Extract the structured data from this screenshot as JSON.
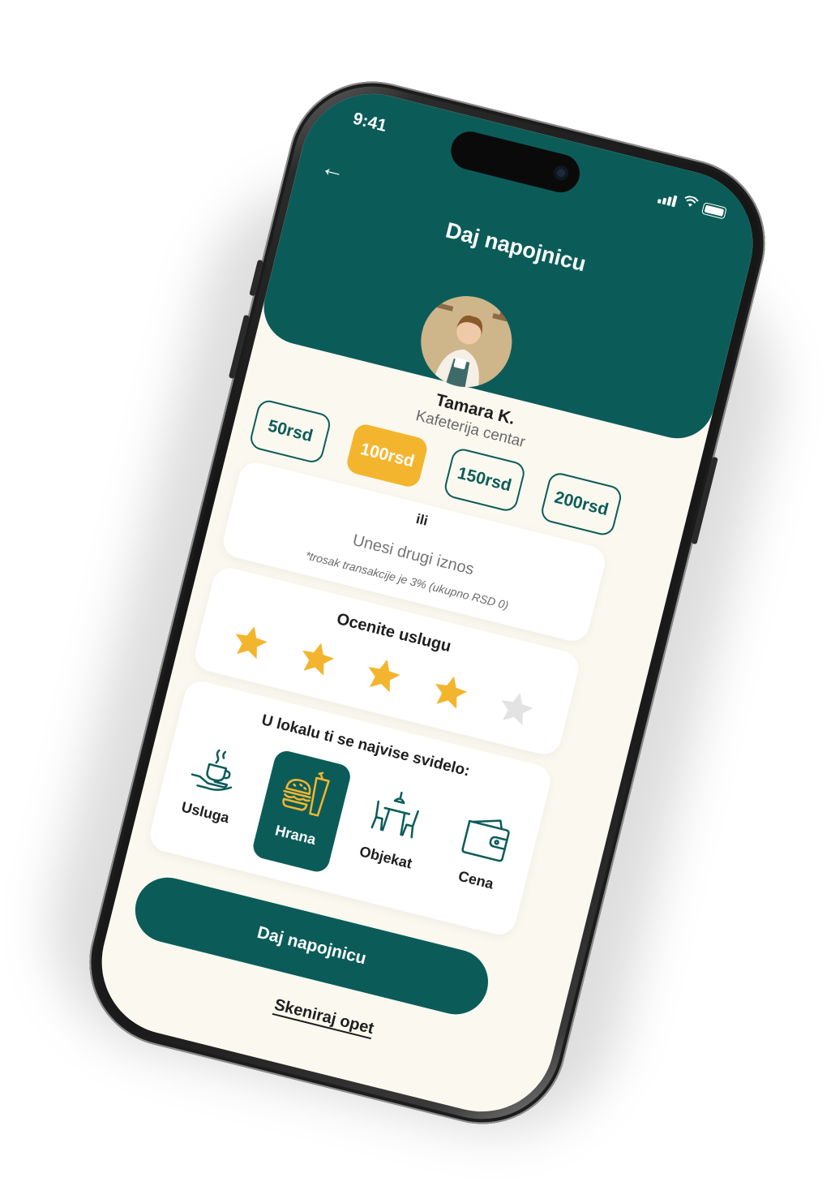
{
  "status_bar": {
    "time": "9:41"
  },
  "header": {
    "back_icon": "arrow-left-icon",
    "title": "Daj napojnicu"
  },
  "profile": {
    "name": "Tamara K.",
    "place": "Kafeterija centar"
  },
  "amounts": [
    {
      "label": "50rsd",
      "selected": false
    },
    {
      "label": "100rsd",
      "selected": true
    },
    {
      "label": "150rsd",
      "selected": false
    },
    {
      "label": "200rsd",
      "selected": false
    }
  ],
  "custom_amount": {
    "or_label": "ili",
    "placeholder": "Unesi drugi iznos",
    "fee_note": "*trosak transakcije je 3% (ukupno RSD 0)"
  },
  "rating": {
    "title": "Ocenite uslugu",
    "value": 4,
    "max": 5
  },
  "favorites": {
    "title": "U lokalu ti se najvise svidelo:",
    "items": [
      {
        "label": "Usluga",
        "icon": "coffee-serving-icon",
        "selected": false
      },
      {
        "label": "Hrana",
        "icon": "burger-drink-icon",
        "selected": true
      },
      {
        "label": "Objekat",
        "icon": "table-chairs-icon",
        "selected": false
      },
      {
        "label": "Cena",
        "icon": "wallet-icon",
        "selected": false
      }
    ]
  },
  "actions": {
    "submit_label": "Daj napojnicu",
    "rescan_label": "Skeniraj opet"
  },
  "colors": {
    "primary": "#0b5c59",
    "accent": "#f4b52e",
    "background": "#fbf9ef",
    "star_empty": "#e3e3e3"
  }
}
